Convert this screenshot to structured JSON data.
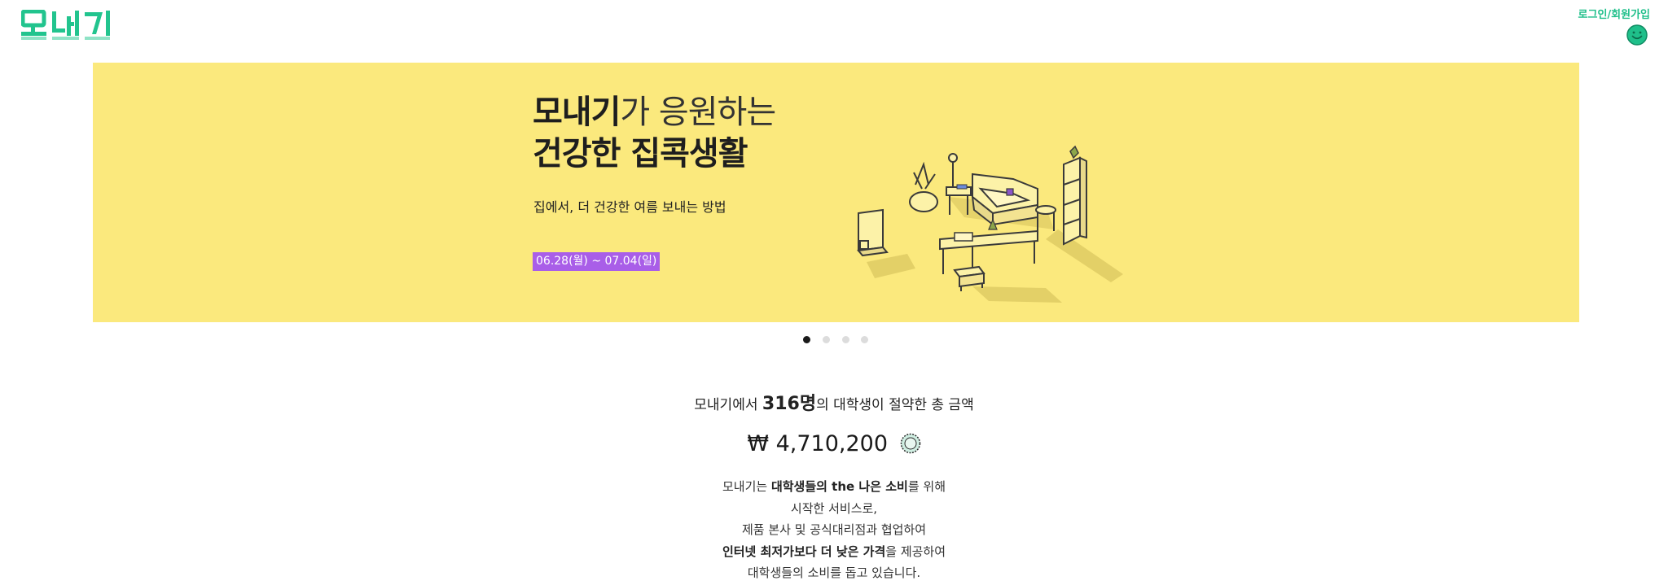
{
  "header": {
    "logo_text": "모내기",
    "auth_link": "로그인/회원가입"
  },
  "banner": {
    "title_bold": "모내기",
    "title_light": "가 응원하는",
    "title_line2": "건강한 집콕생활",
    "subtitle": "집에서, 더 건강한 여름 보내는 방법",
    "date_range": "06.28(월) ~ 07.04(일)"
  },
  "carousel": {
    "slide_count": 4,
    "active_index": 0
  },
  "savings": {
    "prefix": "모내기에서 ",
    "count": "316명",
    "suffix": "의 대학생이 절약한 총 금액",
    "amount": "₩ 4,710,200"
  },
  "description": {
    "line1_a": "모내기는 ",
    "line1_b": "대학생들의 the 나은 소비",
    "line1_c": "를 위해",
    "line2": "시작한 서비스로,",
    "line3": "제품 본사 및 공식대리점과 협업하여",
    "line4_a": "인터넷 최저가보다 더 낮은 가격",
    "line4_b": "을 제공하여",
    "line5": "대학생들의 소비를 돕고 있습니다."
  },
  "colors": {
    "brand_green": "#1fbf8a",
    "banner_yellow": "#fbe97d",
    "date_purple": "#a95ee8"
  }
}
